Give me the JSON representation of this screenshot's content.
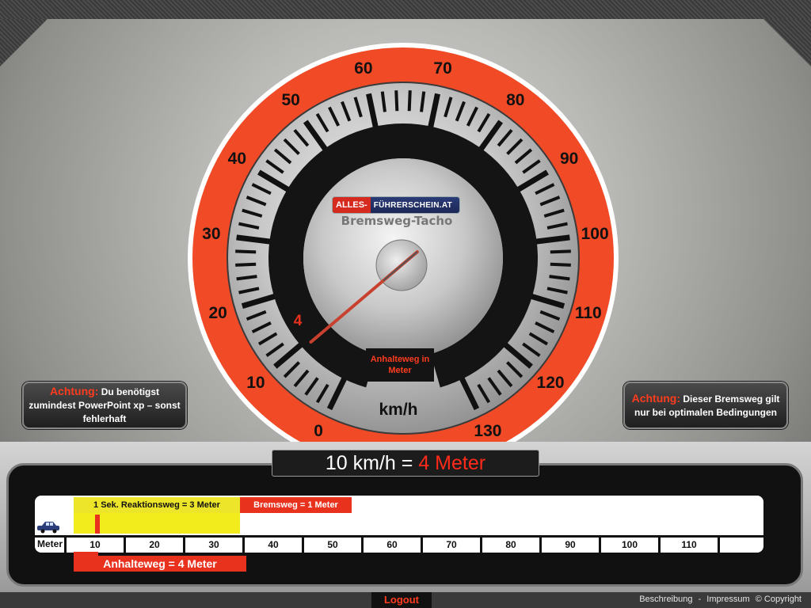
{
  "gauge": {
    "labels": [
      "0",
      "10",
      "20",
      "30",
      "40",
      "50",
      "60",
      "70",
      "80",
      "90",
      "100",
      "110",
      "120",
      "130"
    ],
    "unit": "km/h",
    "needle_value": "4",
    "needle_speed_kmh": 10,
    "anhalteweg_label": "Anhalteweg in Meter",
    "logo_part1": "ALLES-",
    "logo_part2": "FÜHRERSCHEIN.AT",
    "title": "Bremsweg-Tacho"
  },
  "note_left": {
    "title": "Achtung:",
    "text": "Du benötigst zumindest PowerPoint xp – sonst fehlerhaft"
  },
  "note_right": {
    "title": "Achtung:",
    "text": "Dieser Bremsweg gilt nur bei optimalen Bedingungen"
  },
  "result": {
    "speed": "10 km/h",
    "equals": " = ",
    "distance": "4 Meter"
  },
  "bar": {
    "reaktion_label": "1 Sek. Reaktionsweg = 3 Meter",
    "brems_label": "Bremsweg = 1 Meter",
    "meter_label": "Meter",
    "scale": [
      "10",
      "20",
      "30",
      "40",
      "50",
      "60",
      "70",
      "80",
      "90",
      "100",
      "110"
    ],
    "anhalteweg_total": "Anhalteweg = 4 Meter"
  },
  "footer": {
    "logout": "Logout",
    "beschreibung": "Beschreibung",
    "sep": "-",
    "impressum": "Impressum",
    "copyright": "© Copyright"
  },
  "colors": {
    "accent_red": "#e8321e",
    "yellow": "#f2ec1c"
  }
}
